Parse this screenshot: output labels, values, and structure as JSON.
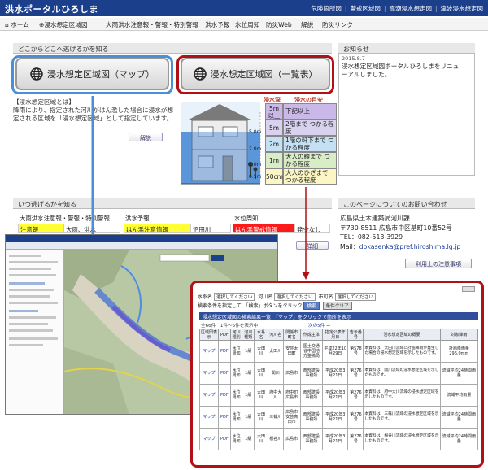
{
  "header": {
    "site_title": "洪水ポータルひろしま",
    "links": [
      "危険箇所図",
      "警戒区域図",
      "高潮浸水想定図",
      "津波浸水想定図"
    ]
  },
  "nav": {
    "items": [
      "ホーム",
      "浸水想定区域図",
      "大雨洪水注意報・警報・特別警報",
      "洪水予報",
      "水位周知",
      "防災Web",
      "解説",
      "防災リンク"
    ]
  },
  "section_where": {
    "heading": "どこからどこへ逃げるかを知る",
    "btn_map": "浸水想定区域図（マップ）",
    "btn_list": "浸水想定区域図（一覧表）",
    "definition_title": "【浸水想定区域とは】",
    "definition_text": "降雨により、指定された河川がはん濫した場合に浸水が想定される区域を「浸水想定区域」として指定しています。",
    "explain_button": "解説"
  },
  "illustration": {
    "col1": "浸水深",
    "col2": "浸水の目安",
    "rows": [
      {
        "depth": "5m 以上",
        "desc": "下記以上"
      },
      {
        "depth": "5m",
        "desc": "2階まで つかる程度"
      },
      {
        "depth": "2m",
        "desc": "1階の軒下まで つかる程度"
      },
      {
        "depth": "1m",
        "desc": "大人の腰まで つかる程度"
      },
      {
        "depth": "50cm",
        "desc": "大人のひざまで つかる程度"
      }
    ],
    "level_labels": [
      "5.0m",
      "2.0m",
      "1.0m",
      "0.5m"
    ]
  },
  "notice": {
    "heading": "お知らせ",
    "date": "2015.8.7",
    "text": "浸水想定区域図ポータルひろしまをリニューアルしました。"
  },
  "section_when": {
    "heading": "いつ逃げるかを知る",
    "col_headers": [
      "大雨洪水注意報・警報・特別警報",
      "洪水予報",
      "水位周知"
    ],
    "cells": [
      "注意報",
      "大雨、洪水",
      "はん濫注意情報",
      "沼田川",
      "はん濫警戒情報",
      "発令なし"
    ],
    "detail_button": "詳細"
  },
  "contact": {
    "heading": "このページについてのお問い合わせ",
    "org": "広島県土木建築局河川課",
    "address": "〒730-8511 広島市中区基町10番52号",
    "tel": "TEL：082-513-3929",
    "mail_label": "Mail：",
    "mail": "dokasenka@pref.hiroshima.lg.jp",
    "notes_button": "利用上の注意事項"
  },
  "list_screen": {
    "filters": [
      "水系名",
      "選択してください",
      "河川名",
      "選択してください",
      "市町名",
      "選択してください"
    ],
    "keyword_label": "検索条件を指定して、「検索」ボタンをクリック",
    "search_btn": "検索",
    "clear_btn": "条件クリア",
    "title": "浸水想定区域図の検索結果一覧　「マップ」をクリックで箇所を表示",
    "count": "全66件　1件～5件を表示中",
    "next_link": "次の5件 →",
    "columns": [
      "区域図表示",
      "PDF",
      "河川種別",
      "河川種類",
      "水系名",
      "河川名",
      "関係市町名",
      "作成主体",
      "指定公表年月日",
      "告示番号",
      "浸水想定区域の概要",
      "対象降雨"
    ],
    "rows": [
      [
        "マップ",
        "PDF",
        "水位周知",
        "1級",
        "太田川",
        "太田川",
        "安芸太田町",
        "国土交通省中国地方整備局",
        "平成22年10月29日",
        "第578号",
        "本資料は、太田川流域に計画降雨が発生した場合の浸水想定区域を示したものです。",
        "計画降雨量296.0mm"
      ],
      [
        "マップ",
        "PDF",
        "水位周知",
        "1級",
        "太田川",
        "関川",
        "広島市",
        "西部建設事務所",
        "平成20年3月21日",
        "第276号",
        "本資料は、関川流域の浸水想定区域を示したものです。",
        "流域平均24時間雨量"
      ],
      [
        "マップ",
        "PDF",
        "水位周知",
        "1級",
        "太田川",
        "府中大川",
        "府中町 広島市",
        "西部建設事務所",
        "平成20年3月21日",
        "第276号",
        "本資料は、府中大川流域の浸水想定区域を示したものです。",
        "流域平均雨量"
      ],
      [
        "マップ",
        "PDF",
        "水位周知",
        "1級",
        "太田川",
        "三篠川",
        "広島市 安芸高田市",
        "西部建設事務所",
        "平成20年3月21日",
        "第276号",
        "本資料は、三篠川流域の浸水想定区域を示したものです。",
        "流域平均24時間雨量"
      ],
      [
        "マップ",
        "PDF",
        "水位周知",
        "1級",
        "太田川",
        "根谷川",
        "広島市",
        "西部建設事務所",
        "平成20年3月21日",
        "第276号",
        "本資料は、根谷川流域の浸水想定区域を示したものです。",
        "流域平均24時間雨量"
      ]
    ]
  },
  "colors": {
    "brand": "#1c3f8c",
    "map_outline": "#4a8fd8",
    "list_outline": "#b01016",
    "warning_yellow": "#ffff33",
    "danger_red": "#ff1a1a"
  }
}
